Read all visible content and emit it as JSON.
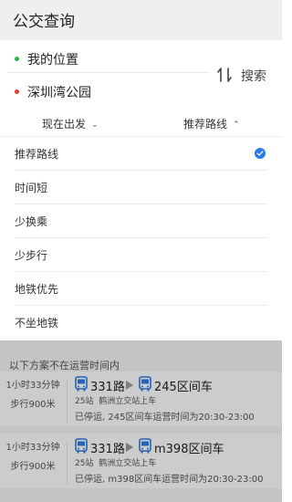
{
  "header": {
    "title": "公交查询"
  },
  "search": {
    "from": "我的位置",
    "to": "深圳湾公园",
    "search_label": "搜索"
  },
  "filters": {
    "time_label": "现在出发",
    "route_label": "推荐路线"
  },
  "route_options": [
    {
      "label": "推荐路线",
      "selected": true
    },
    {
      "label": "时间短",
      "selected": false
    },
    {
      "label": "少换乘",
      "selected": false
    },
    {
      "label": "少步行",
      "selected": false
    },
    {
      "label": "地铁优先",
      "selected": false
    },
    {
      "label": "不坐地铁",
      "selected": false
    }
  ],
  "results": {
    "notice": "以下方案不在运营时间内",
    "items": [
      {
        "duration": "1小时33分钟",
        "walk": "步行900米",
        "line1": "331路",
        "line2": "245区间车",
        "stops": "25站",
        "board": "鹤洲立交站上车",
        "warning": "已停运, 245区间车运营时间为20:30-23:00"
      },
      {
        "duration": "1小时33分钟",
        "walk": "步行900米",
        "line1": "331路",
        "line2": "m398区间车",
        "stops": "25站",
        "board": "鹤洲立交站上车",
        "warning": "已停运, m398区间车运营时间为20:30-23:00"
      }
    ]
  },
  "colors": {
    "accent": "#2d7be5",
    "start_dot": "#2db34a",
    "end_dot": "#e43b2f",
    "header_bg": "#efefef"
  }
}
